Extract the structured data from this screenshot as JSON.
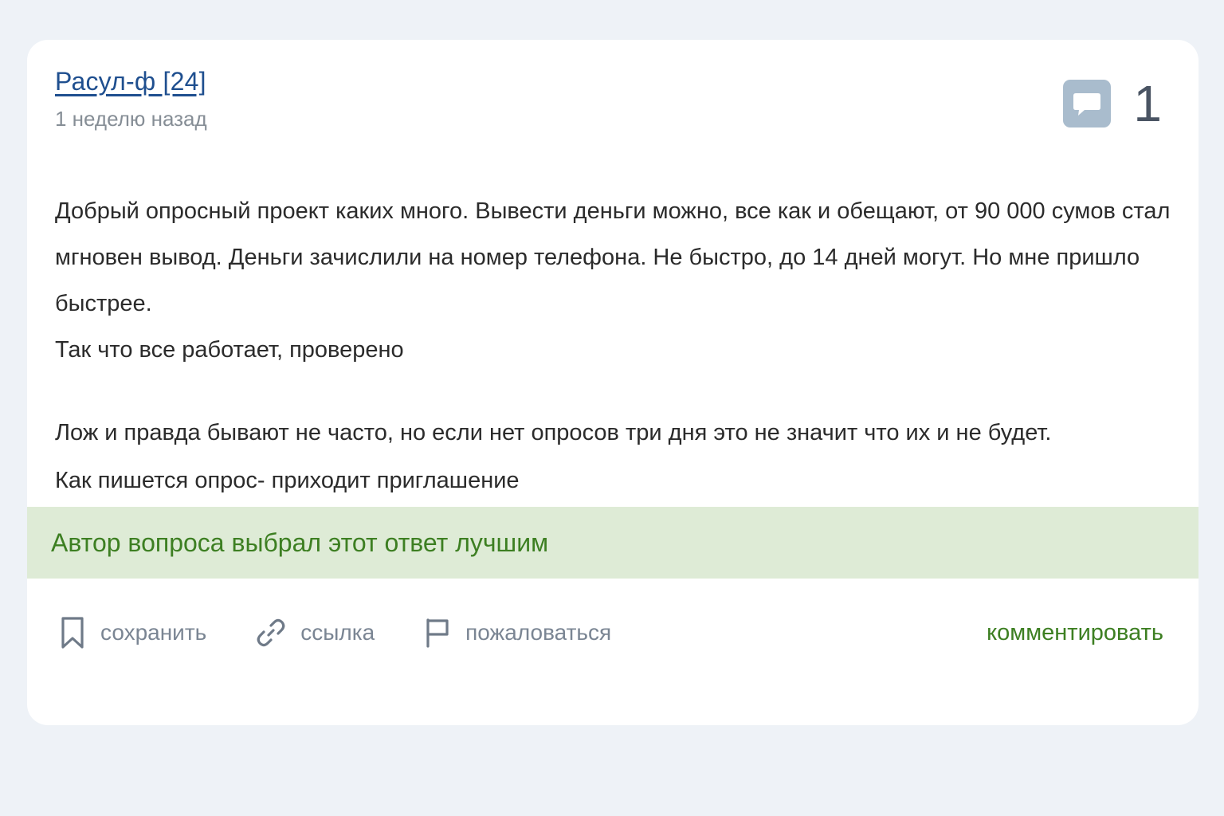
{
  "answer": {
    "author": "Расул-ф [24]",
    "timestamp": "1 неделю назад",
    "comment_count": "1",
    "paragraphs": [
      "Добрый опросный проект каких много. Вывести деньги можно, все как и обещают, от 90 000 сумов стал",
      "мгновен вывод. Деньги зачислили на номер телефона. Не быстро, до 14 дней могут. Но мне пришло быстрее.",
      "Так что все работает, проверено",
      "Лож и правда бывают не часто, но если нет опросов три дня это не значит что их и не будет.",
      "Как пишется опрос- приходит приглашение"
    ],
    "best_answer_label": "Автор вопроса выбрал этот ответ лучшим"
  },
  "actions": {
    "save_label": "сохранить",
    "link_label": "ссылка",
    "report_label": "пожаловаться",
    "comment_label": "комментировать"
  },
  "icons": {
    "comment": "speech-bubble-icon",
    "save": "bookmark-icon",
    "link": "chain-link-icon",
    "report": "flag-icon"
  },
  "colors": {
    "author_link": "#1f4f8f",
    "accent_green": "#3d7f22",
    "best_banner_bg": "#deebd6",
    "muted": "#868e96"
  }
}
